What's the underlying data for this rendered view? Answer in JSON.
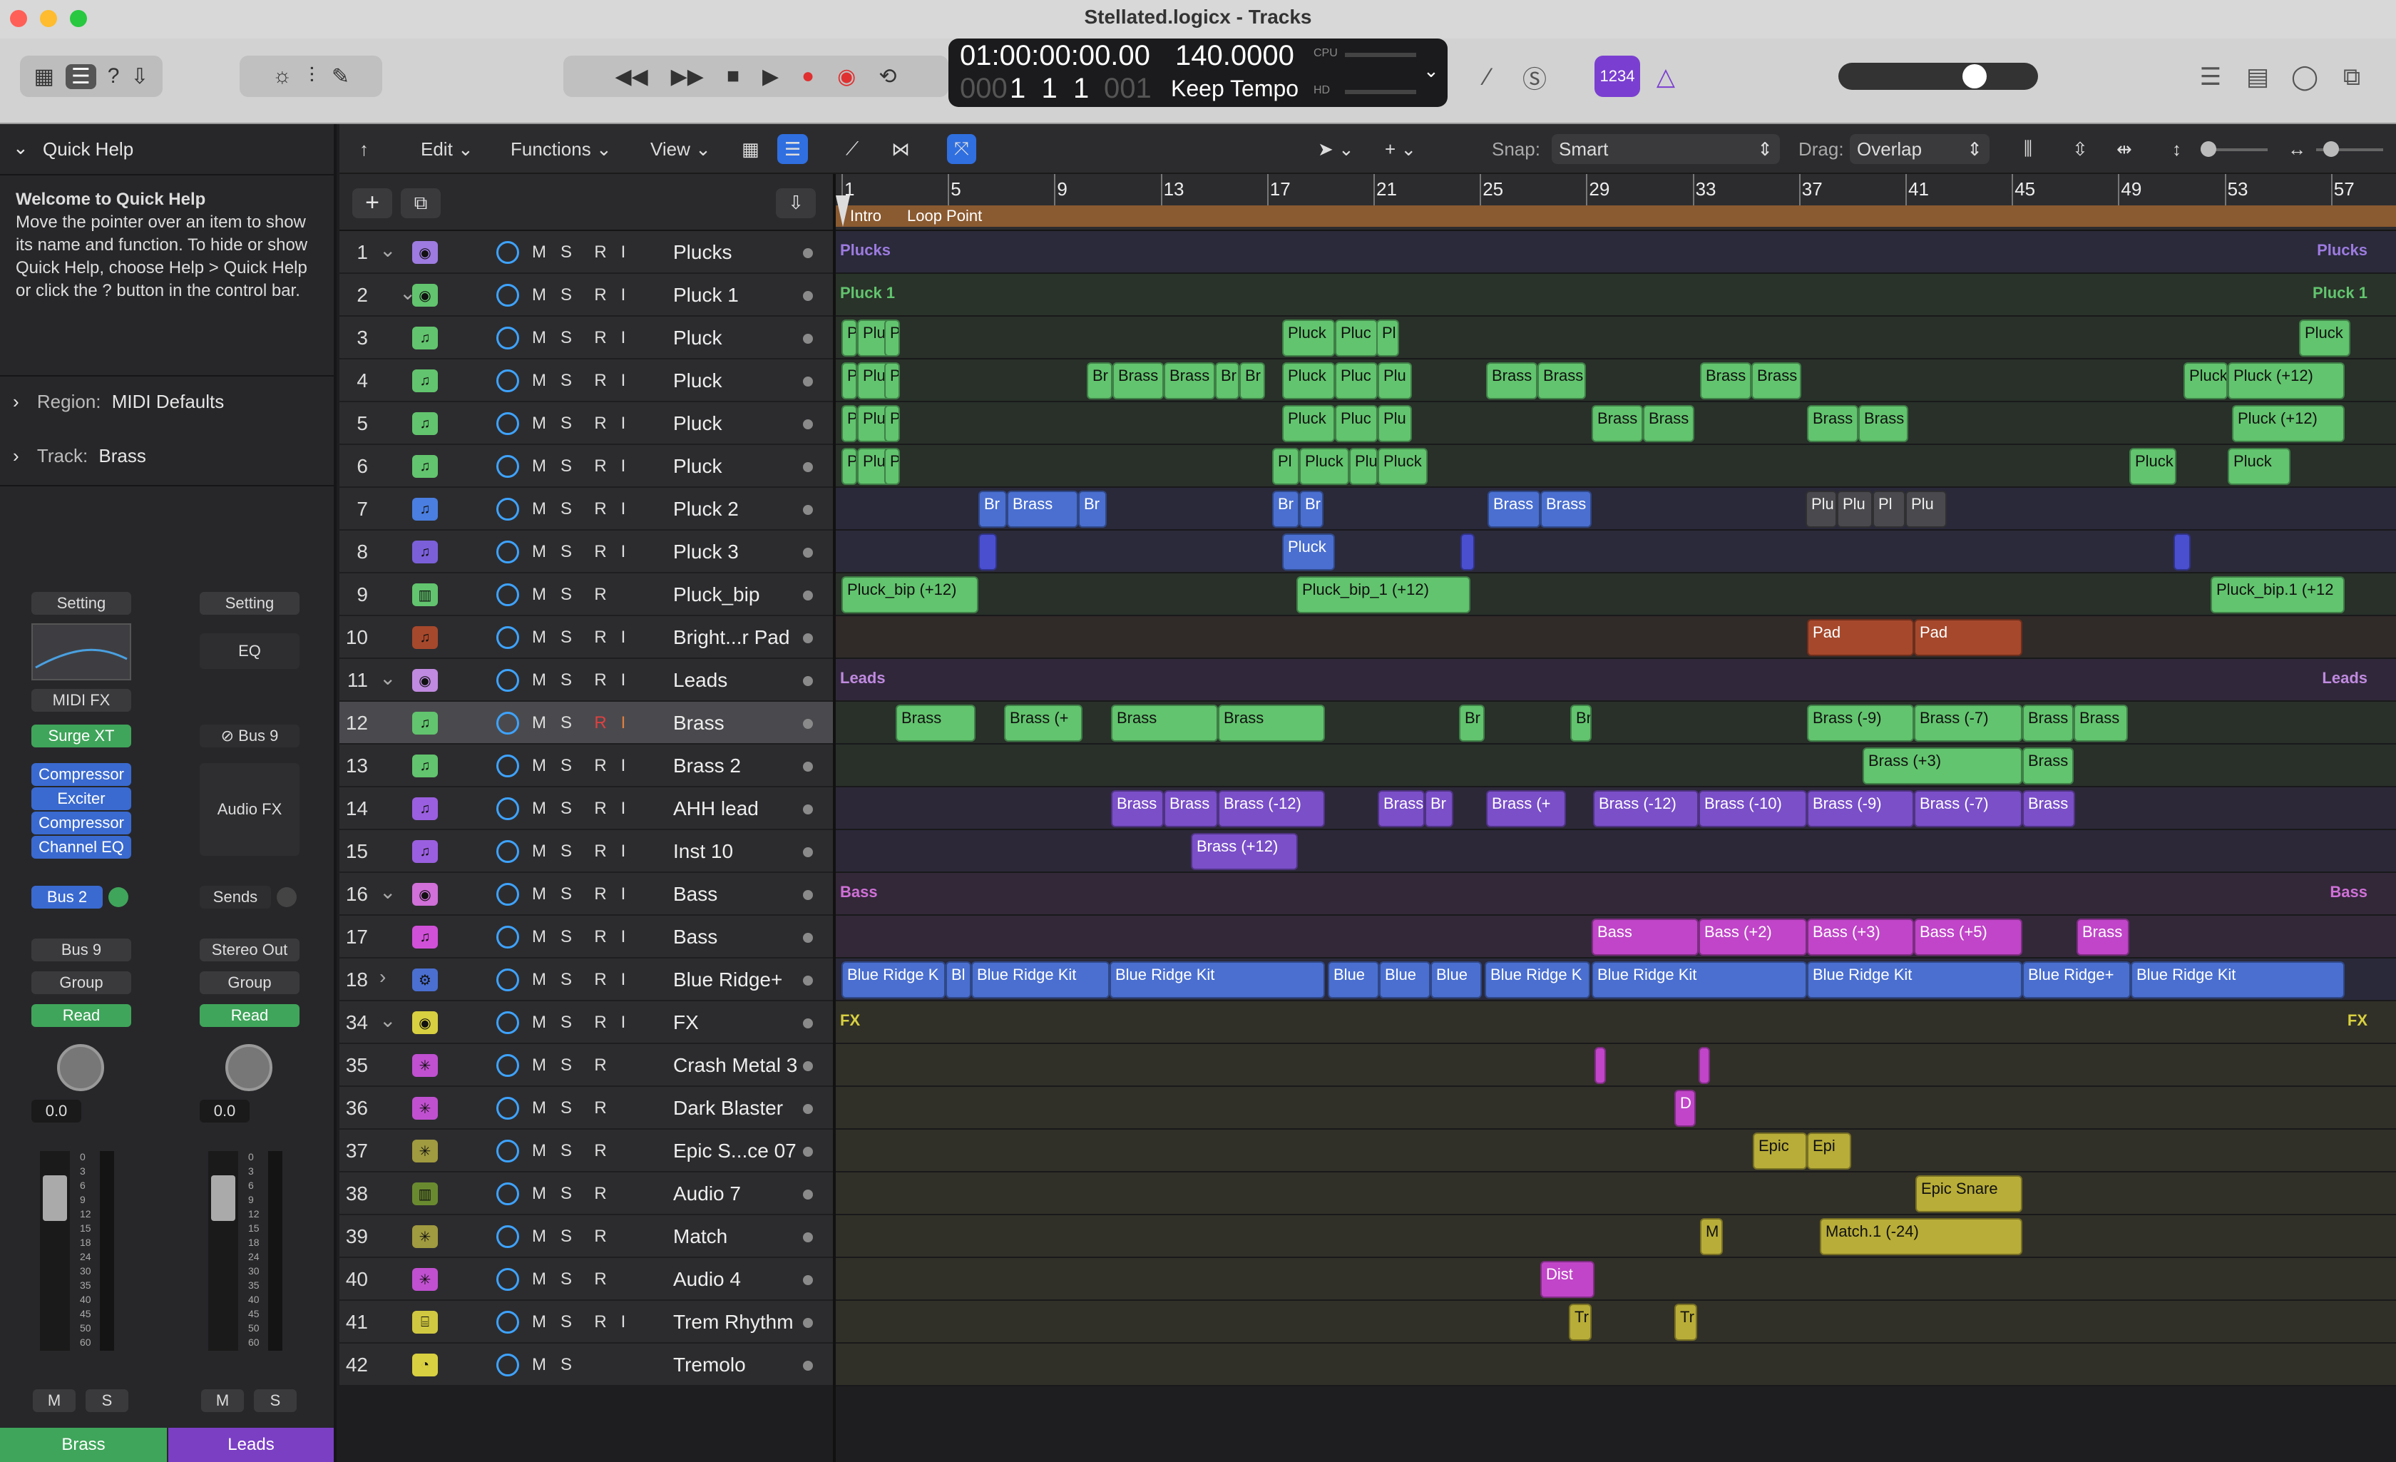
{
  "window": {
    "title": "Stellated.logicx - Tracks"
  },
  "lcd": {
    "time": "01:00:00:00.00",
    "bars": "1  1  1",
    "bars_dim": "000",
    "sub": "001",
    "tempo": "140.0000",
    "tempo_mode": "Keep Tempo",
    "cpu": "CPU",
    "hd": "HD"
  },
  "controlbar": {
    "count_in": "1234"
  },
  "quick_help": {
    "header": "Quick Help",
    "title": "Welcome to Quick Help",
    "body": "Move the pointer over an item to show its name and function. To hide or show Quick Help, choose Help > Quick Help or click the ? button in the control bar.",
    "region_label": "Region:",
    "region_value": "MIDI Defaults",
    "track_label": "Track:",
    "track_value": "Brass"
  },
  "channel_strips": [
    {
      "setting": "Setting",
      "midi_fx": "MIDI FX",
      "instrument": "Surge XT",
      "plugins": [
        "Compressor",
        "Exciter",
        "Compressor",
        "Channel EQ"
      ],
      "send": "Bus 2",
      "output": "Bus 9",
      "group": "Group",
      "automation": "Read",
      "volume": "0.0",
      "mute": "M",
      "solo": "S",
      "name": "Brass",
      "color": "#3fa55a"
    },
    {
      "setting": "Setting",
      "eq": "EQ",
      "input": "Bus 9",
      "audio_fx": "Audio FX",
      "sends": "Sends",
      "output": "Stereo Out",
      "group": "Group",
      "automation": "Read",
      "volume": "0.0",
      "mute": "M",
      "solo": "S",
      "name": "Leads",
      "color": "#7b3fc4"
    }
  ],
  "fader_scale": [
    "0",
    "3",
    "6",
    "9",
    "12",
    "15",
    "18",
    "24",
    "30",
    "35",
    "40",
    "45",
    "50",
    "60"
  ],
  "toolbar": {
    "edit": "Edit",
    "functions": "Functions",
    "view": "View",
    "snap_label": "Snap:",
    "snap_value": "Smart",
    "drag_label": "Drag:",
    "drag_value": "Overlap"
  },
  "ruler": {
    "bars": [
      "1",
      "5",
      "9",
      "13",
      "17",
      "21",
      "25",
      "29",
      "33",
      "37",
      "41",
      "45",
      "49",
      "53",
      "57"
    ],
    "markers": [
      "Intro",
      "Loop Point"
    ]
  },
  "tracks": [
    {
      "num": "1",
      "name": "Plucks",
      "icon": "folder",
      "color": "#9d7be0"
    },
    {
      "num": "2",
      "name": "Pluck 1",
      "icon": "folder",
      "color": "#62c46e"
    },
    {
      "num": "3",
      "name": "Pluck",
      "icon": "note",
      "color": "#62c46e"
    },
    {
      "num": "4",
      "name": "Pluck",
      "icon": "note",
      "color": "#62c46e"
    },
    {
      "num": "5",
      "name": "Pluck",
      "icon": "note",
      "color": "#62c46e"
    },
    {
      "num": "6",
      "name": "Pluck",
      "icon": "note",
      "color": "#62c46e"
    },
    {
      "num": "7",
      "name": "Pluck 2",
      "icon": "note",
      "color": "#4a7ee0"
    },
    {
      "num": "8",
      "name": "Pluck 3",
      "icon": "note",
      "color": "#7a5fd8"
    },
    {
      "num": "9",
      "name": "Pluck_bip",
      "icon": "wave",
      "color": "#62c46e"
    },
    {
      "num": "10",
      "name": "Bright...r Pad",
      "icon": "note",
      "color": "#a6482c"
    },
    {
      "num": "11",
      "name": "Leads",
      "icon": "folder",
      "color": "#c08ae0"
    },
    {
      "num": "12",
      "name": "Brass",
      "icon": "note",
      "color": "#62c46e"
    },
    {
      "num": "13",
      "name": "Brass 2",
      "icon": "note",
      "color": "#62c46e"
    },
    {
      "num": "14",
      "name": "AHH lead",
      "icon": "note",
      "color": "#9a5fe0"
    },
    {
      "num": "15",
      "name": "Inst 10",
      "icon": "note",
      "color": "#9a5fe0"
    },
    {
      "num": "16",
      "name": "Bass",
      "icon": "folder",
      "color": "#d070d8"
    },
    {
      "num": "17",
      "name": "Bass",
      "icon": "note",
      "color": "#d050d8"
    },
    {
      "num": "18",
      "name": "Blue Ridge+",
      "icon": "drum",
      "color": "#4a6fd0"
    },
    {
      "num": "34",
      "name": "FX",
      "icon": "folder",
      "color": "#d8d040"
    },
    {
      "num": "35",
      "name": "Crash Metal 3",
      "icon": "burst",
      "color": "#c050d0"
    },
    {
      "num": "36",
      "name": "Dark Blaster",
      "icon": "burst",
      "color": "#c050d0"
    },
    {
      "num": "37",
      "name": "Epic S...ce 07",
      "icon": "burst",
      "color": "#a09a40"
    },
    {
      "num": "38",
      "name": "Audio 7",
      "icon": "wave",
      "color": "#6a8a30"
    },
    {
      "num": "39",
      "name": "Match",
      "icon": "burst",
      "color": "#a09a40"
    },
    {
      "num": "40",
      "name": "Audio 4",
      "icon": "burst",
      "color": "#c050d0"
    },
    {
      "num": "41",
      "name": "Trem Rhythm",
      "icon": "xylo",
      "color": "#d0c840"
    },
    {
      "num": "42",
      "name": "Tremolo",
      "icon": "clock",
      "color": "#d8d040"
    }
  ],
  "track_buttons": {
    "mute": "M",
    "solo": "S",
    "record": "R",
    "input": "I"
  },
  "regions": [
    {
      "track": 0,
      "type": "folder",
      "label": "Plucks",
      "label_end": "Plucks",
      "color": "#9d7be0"
    },
    {
      "track": 1,
      "type": "folder",
      "label": "Pluck 1",
      "label_end": "Pluck 1",
      "color": "#62c46e"
    },
    {
      "track": 2,
      "items": [
        [
          "Pl",
          "green"
        ],
        [
          "Plu",
          "green"
        ],
        [
          "Pl",
          "green"
        ],
        [
          "Pluck",
          "green"
        ],
        [
          "Pluc",
          "green"
        ],
        [
          "Pl",
          "green"
        ],
        [
          "Pluck",
          "green"
        ]
      ]
    },
    {
      "track": 3,
      "items": [
        [
          "Pl",
          "green"
        ],
        [
          "Plu",
          "green"
        ],
        [
          "Pl",
          "green"
        ],
        [
          "Br",
          "green"
        ],
        [
          "Brass",
          "green"
        ],
        [
          "Brass",
          "green"
        ],
        [
          "Br",
          "green"
        ],
        [
          "Br",
          "green"
        ],
        [
          "Pluck",
          "green"
        ],
        [
          "Pluc",
          "green"
        ],
        [
          "Plu",
          "green"
        ],
        [
          "Brass",
          "green"
        ],
        [
          "Brass",
          "green"
        ],
        [
          "Brass",
          "green"
        ],
        [
          "Brass",
          "green"
        ],
        [
          "Pluck",
          "green"
        ],
        [
          "Pluck (+12)",
          "green"
        ]
      ]
    },
    {
      "track": 4,
      "items": [
        [
          "Pl",
          "green"
        ],
        [
          "Plu",
          "green"
        ],
        [
          "Pl",
          "green"
        ],
        [
          "Pluck",
          "green"
        ],
        [
          "Pluc",
          "green"
        ],
        [
          "Plu",
          "green"
        ],
        [
          "Brass",
          "green"
        ],
        [
          "Brass",
          "green"
        ],
        [
          "Brass",
          "green"
        ],
        [
          "Brass",
          "green"
        ],
        [
          "Pluck (+12)",
          "green"
        ]
      ]
    },
    {
      "track": 5,
      "items": [
        [
          "Pl",
          "green"
        ],
        [
          "Plu",
          "green"
        ],
        [
          "Pl",
          "green"
        ],
        [
          "Pl",
          "green"
        ],
        [
          "Pluck",
          "green"
        ],
        [
          "Pluc",
          "green"
        ],
        [
          "Pluck",
          "green"
        ],
        [
          "Pluck",
          "green"
        ],
        [
          "Pluck",
          "green"
        ]
      ]
    },
    {
      "track": 6,
      "items": [
        [
          "Br",
          "blue"
        ],
        [
          "Brass",
          "blue"
        ],
        [
          "Br",
          "blue"
        ],
        [
          "Br",
          "blue"
        ],
        [
          "Br",
          "blue"
        ],
        [
          "Brass",
          "blue"
        ],
        [
          "Brass",
          "blue"
        ],
        [
          "Plu",
          "grey"
        ],
        [
          "Plu",
          "grey"
        ],
        [
          "Pl",
          "grey"
        ],
        [
          "Plu",
          "grey"
        ]
      ]
    },
    {
      "track": 7,
      "items": [
        [
          "Pluck",
          "blue"
        ]
      ]
    },
    {
      "track": 8,
      "items": [
        [
          "Pluck_bip (+12)",
          "green"
        ],
        [
          "Pluck_bip_1 (+12)",
          "green"
        ],
        [
          "Pluck_bip.1 (+12",
          "green"
        ]
      ]
    },
    {
      "track": 9,
      "items": [
        [
          "Pad",
          "orange"
        ],
        [
          "Pad",
          "orange"
        ]
      ]
    },
    {
      "track": 10,
      "type": "folder",
      "label": "Leads",
      "label_end": "Leads",
      "color": "#c08ae0"
    },
    {
      "track": 11,
      "items": [
        [
          "Brass",
          "green"
        ],
        [
          "Brass (+",
          "green"
        ],
        [
          "Brass",
          "green"
        ],
        [
          "Brass",
          "green"
        ],
        [
          "Br",
          "green"
        ],
        [
          "Br",
          "green"
        ],
        [
          "Brass (-9)",
          "green"
        ],
        [
          "Brass (-7)",
          "green"
        ],
        [
          "Brass",
          "green"
        ],
        [
          "Brass",
          "green"
        ]
      ]
    },
    {
      "track": 12,
      "items": [
        [
          "Brass (+3)",
          "green"
        ],
        [
          "Brass",
          "green"
        ]
      ]
    },
    {
      "track": 13,
      "items": [
        [
          "Brass",
          "purple"
        ],
        [
          "Brass",
          "purple"
        ],
        [
          "Brass (-12)",
          "purple"
        ],
        [
          "Brass",
          "purple"
        ],
        [
          "Br",
          "purple"
        ],
        [
          "Brass (+",
          "purple"
        ],
        [
          "Brass (-12)",
          "purple"
        ],
        [
          "Brass (-10)",
          "purple"
        ],
        [
          "Brass (-9)",
          "purple"
        ],
        [
          "Brass (-7)",
          "purple"
        ],
        [
          "Brass",
          "purple"
        ]
      ]
    },
    {
      "track": 14,
      "items": [
        [
          "Brass (+12)",
          "purple"
        ]
      ]
    },
    {
      "track": 15,
      "type": "folder",
      "label": "Bass",
      "label_end": "Bass",
      "color": "#d070d8"
    },
    {
      "track": 16,
      "items": [
        [
          "Bass",
          "pink"
        ],
        [
          "Bass (+2)",
          "pink"
        ],
        [
          "Bass (+3)",
          "pink"
        ],
        [
          "Bass (+5)",
          "pink"
        ],
        [
          "Brass",
          "pink"
        ]
      ]
    },
    {
      "track": 17,
      "items": [
        [
          "Blue Ridge K",
          "blue"
        ],
        [
          "Bl",
          "blue"
        ],
        [
          "Blue Ridge Kit",
          "blue"
        ],
        [
          "Blue Ridge Kit",
          "blue"
        ],
        [
          "Blue",
          "blue"
        ],
        [
          "Blue",
          "blue"
        ],
        [
          "Blue",
          "blue"
        ],
        [
          "Blue Ridge K",
          "blue"
        ],
        [
          "Blue Ridge Kit",
          "blue"
        ],
        [
          "Blue Ridge Kit",
          "blue"
        ],
        [
          "Blue Ridge+",
          "blue"
        ],
        [
          "Blue Ridge Kit",
          "blue"
        ]
      ]
    },
    {
      "track": 18,
      "type": "folder",
      "label": "FX",
      "label_end": "FX",
      "color": "#d8d040"
    },
    {
      "track": 19,
      "items": []
    },
    {
      "track": 20,
      "items": [
        [
          "D",
          "pink"
        ]
      ]
    },
    {
      "track": 21,
      "items": [
        [
          "Epic",
          "yellow"
        ],
        [
          "Epi",
          "yellow"
        ]
      ]
    },
    {
      "track": 22,
      "items": [
        [
          "Epic Snare",
          "yellow"
        ]
      ]
    },
    {
      "track": 23,
      "items": [
        [
          "M",
          "yellow"
        ],
        [
          "Match.1 (-24)",
          "yellow"
        ]
      ]
    },
    {
      "track": 24,
      "items": [
        [
          "Dist",
          "pink"
        ]
      ]
    },
    {
      "track": 25,
      "items": [
        [
          "Tr",
          "yellow"
        ],
        [
          "Tr",
          "yellow"
        ]
      ]
    },
    {
      "track": 26,
      "items": []
    }
  ]
}
